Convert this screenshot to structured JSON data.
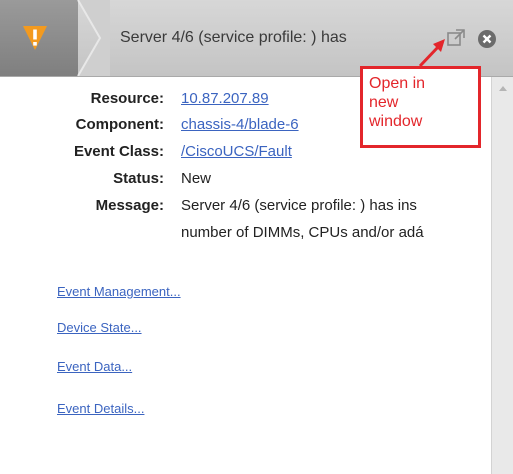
{
  "header": {
    "title": "Server 4/6 (service profile: ) has",
    "severity_icon": "warning-icon",
    "popout_icon": "external-window-icon",
    "close_icon": "close-circle-icon",
    "colors": {
      "severity": "#f39a1e",
      "header": "#cfcfcf",
      "close": "#6b6b6b"
    }
  },
  "callout": {
    "lines": [
      "Open in",
      "new",
      "window"
    ],
    "color": "#e3262b"
  },
  "details": {
    "resource_label": "Resource:",
    "resource_value": "10.87.207.89",
    "component_label": "Component:",
    "component_value": "chassis-4/blade-6",
    "event_class_label": "Event Class:",
    "event_class_value": "/CiscoUCS/Fault",
    "status_label": "Status:",
    "status_value": "New",
    "message_label": "Message:",
    "message_line1": "Server 4/6 (service profile: ) has ins",
    "message_line2": "number of DIMMs, CPUs and/or adá"
  },
  "links": [
    "Event Management...",
    "Device State...",
    "Event Data...",
    "Event Details..."
  ],
  "link_color": "#3b64c0"
}
